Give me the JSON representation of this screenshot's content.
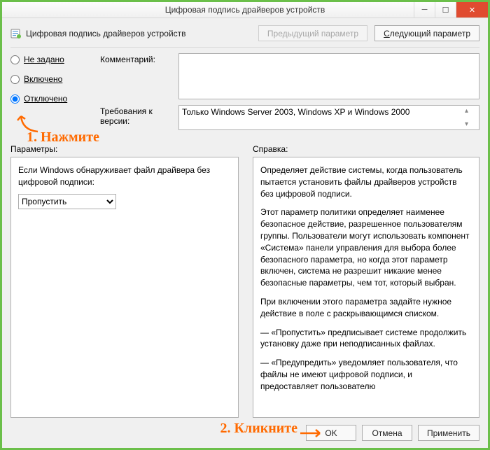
{
  "window": {
    "title": "Цифровая подпись драйверов устройств"
  },
  "header": {
    "title": "Цифровая подпись драйверов устройств",
    "prev_btn": "Предыдущий параметр",
    "next_btn": "Следующий параметр",
    "next_uline": "С"
  },
  "radios": {
    "not_configured": "Не задано",
    "enabled": "Включено",
    "disabled": "Отключено"
  },
  "fields": {
    "comment_label": "Комментарий:",
    "comment_value": "",
    "req_label": "Требования к версии:",
    "req_value": "Только Windows Server 2003, Windows XP и Windows 2000"
  },
  "lower": {
    "params_label": "Параметры:",
    "help_label": "Справка:",
    "params_text": "Если Windows обнаруживает файл драйвера без цифровой подписи:",
    "combo_value": "Пропустить",
    "help_paras": [
      "Определяет действие системы, когда пользователь пытается установить файлы драйверов устройств без цифровой подписи.",
      "Этот параметр политики определяет наименее безопасное действие, разрешенное пользователям группы. Пользователи могут использовать компонент «Система» панели управления для выбора более безопасного параметра, но когда этот параметр включен, система не разрешит никакие менее безопасные параметры, чем тот, который выбран.",
      "При включении этого параметра задайте нужное действие в поле с раскрывающимся списком.",
      "— «Пропустить» предписывает системе продолжить установку даже при неподписанных файлах.",
      "— «Предупредить» уведомляет пользователя, что файлы не имеют цифровой подписи, и предоставляет пользователю"
    ]
  },
  "footer": {
    "ok": "OK",
    "cancel": "Отмена",
    "apply": "Применить"
  },
  "annotations": {
    "step1": "1. Нажмите",
    "step2": "2. Кликните"
  }
}
